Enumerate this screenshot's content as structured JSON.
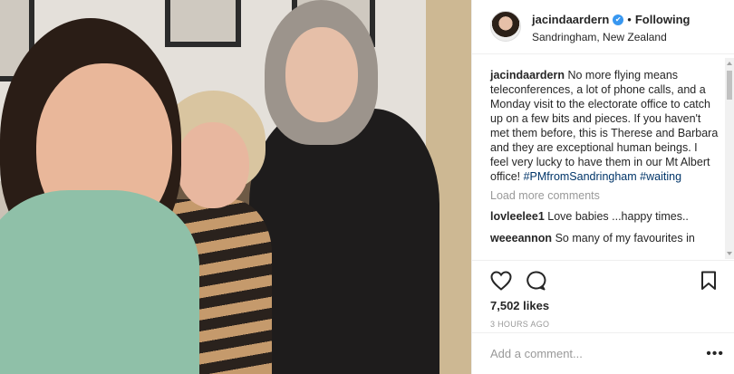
{
  "post": {
    "username": "jacindaardern",
    "verified_mark": "✔",
    "separator": "•",
    "follow_status": "Following",
    "location": "Sandringham, New Zealand",
    "caption_text": "No more flying means teleconferences, a lot of phone calls, and a Monday visit to the electorate office to catch up on a few bits and pieces. If you haven't met them before, this is Therese and Barbara and they are exceptional human beings. I feel very lucky to have them in our Mt Albert office!",
    "hashtags": [
      "#PMfromSandringham",
      "#waiting"
    ],
    "load_more": "Load more comments",
    "comments": [
      {
        "user": "lovleelee1",
        "text": "Love babies ...happy times.."
      },
      {
        "user": "weeeannon",
        "text": "So many of my favourites in"
      }
    ],
    "likes": "7,502 likes",
    "time": "3 HOURS AGO",
    "add_comment_placeholder": "Add a comment...",
    "more_options": "•••"
  },
  "icons": [
    "heart-icon",
    "comment-icon",
    "bookmark-icon",
    "verified-icon"
  ]
}
